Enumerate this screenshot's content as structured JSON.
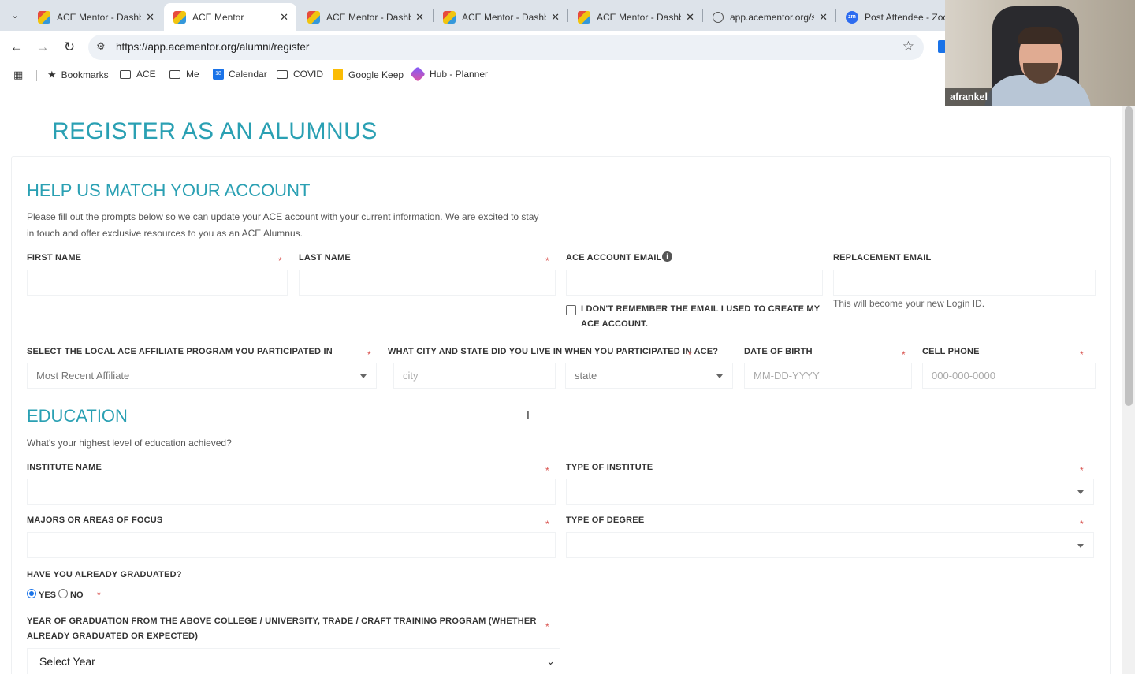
{
  "browser": {
    "tabs": [
      {
        "title": "ACE Mentor - Dashboard",
        "favicon": "ace-logo"
      },
      {
        "title": "ACE Mentor",
        "favicon": "ace-logo",
        "active": true
      },
      {
        "title": "ACE Mentor - Dashboard",
        "favicon": "ace-logo"
      },
      {
        "title": "ACE Mentor - Dashboard",
        "favicon": "ace-logo"
      },
      {
        "title": "ACE Mentor - Dashboard",
        "favicon": "ace-logo"
      },
      {
        "title": "app.acementor.org/s",
        "favicon": "globe"
      },
      {
        "title": "Post Attendee - Zoom",
        "favicon": "zoom"
      }
    ],
    "url": "https://app.acementor.org/alumni/register",
    "bookmarks": [
      "Bookmarks",
      "ACE",
      "Me",
      "Calendar",
      "COVID",
      "Google Keep",
      "Hub - Planner"
    ],
    "calendar_day": "18",
    "zoom_badge": "zm"
  },
  "video": {
    "participant": "afrankel"
  },
  "page": {
    "title": "REGISTER AS AN ALUMNUS",
    "match": {
      "heading": "HELP US MATCH YOUR ACCOUNT",
      "description_line1": "Please fill out the prompts below so we can update your ACE account with your current information. We are excited to stay",
      "description_line2": "in touch and offer exclusive resources to you as an ACE Alumnus.",
      "first_name_label": "FIRST NAME",
      "last_name_label": "LAST NAME",
      "ace_email_label": "ACE ACCOUNT EMAIL",
      "replacement_email_label": "REPLACEMENT EMAIL",
      "forgot_email_line1": "I DON'T REMEMBER THE EMAIL I USED TO CREATE MY",
      "forgot_email_line2": "ACE ACCOUNT.",
      "replacement_help": "This will become your new Login ID.",
      "affiliate_label": "SELECT THE LOCAL ACE AFFILIATE PROGRAM YOU PARTICIPATED IN",
      "affiliate_value": "Most Recent Affiliate",
      "city_state_label": "WHAT CITY AND STATE DID YOU LIVE IN WHEN YOU PARTICIPATED IN ACE?",
      "city_placeholder": "city",
      "state_value": "state",
      "dob_label": "DATE OF BIRTH",
      "dob_placeholder": "MM-DD-YYYY",
      "cell_label": "CELL PHONE",
      "cell_placeholder": "000-000-0000"
    },
    "education": {
      "heading": "EDUCATION",
      "description": "What's your highest level of education achieved?",
      "institute_name_label": "INSTITUTE NAME",
      "institute_type_label": "TYPE OF INSTITUTE",
      "majors_label": "MAJORS OR AREAS OF FOCUS",
      "degree_type_label": "TYPE OF DEGREE",
      "graduated_label": "HAVE YOU ALREADY GRADUATED?",
      "yes_label": "YES",
      "no_label": "NO",
      "grad_year_label_line1": "YEAR OF GRADUATION FROM THE ABOVE COLLEGE / UNIVERSITY, TRADE / CRAFT TRAINING PROGRAM (WHETHER",
      "grad_year_label_line2": "ALREADY GRADUATED OR EXPECTED)",
      "grad_year_value": "Select Year"
    },
    "required_mark": "*"
  },
  "colors": {
    "accent": "#2aa0b3",
    "required": "#d9534f",
    "radio": "#1a73e8"
  }
}
